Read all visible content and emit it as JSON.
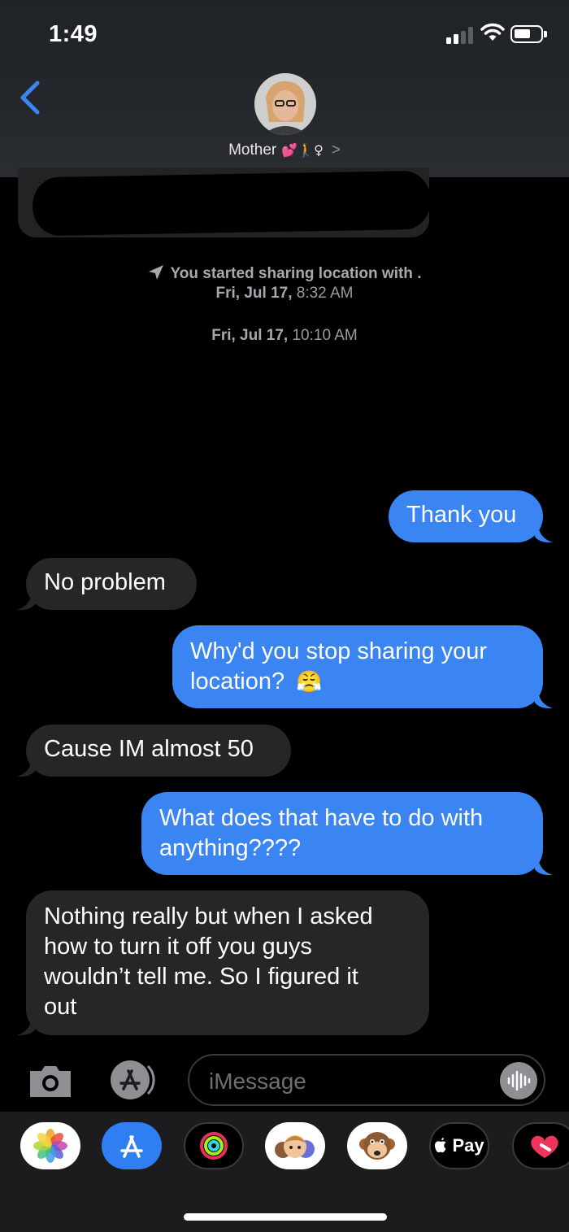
{
  "status_bar": {
    "time": "1:49"
  },
  "header": {
    "contact_name": "Mother",
    "contact_emoji": "💕🚶♀",
    "chevron": ">"
  },
  "conversation": {
    "system_lines": [
      {
        "text": "You started sharing location with .",
        "icon": "location-arrow-icon"
      },
      {
        "date": "Fri, Jul 17,",
        "time": "8:32 AM"
      },
      {
        "date": "Fri, Jul 17,",
        "time": "10:10 AM"
      }
    ],
    "messages": [
      {
        "direction": "outgoing",
        "text": "Thank you"
      },
      {
        "direction": "incoming",
        "text": "No problem"
      },
      {
        "direction": "outgoing",
        "line1": "Why'd you stop sharing your",
        "line2": "location?",
        "emoji": "😤"
      },
      {
        "direction": "incoming",
        "text": "Cause IM almost 50"
      },
      {
        "direction": "outgoing",
        "line1": "What does that have to do with",
        "line2": "anything????"
      },
      {
        "direction": "incoming",
        "line1": "Nothing really but when I asked",
        "line2": "how to turn it off you guys",
        "line3": "wouldn’t tell me. So I figured it",
        "line4": "out"
      }
    ]
  },
  "input_bar": {
    "placeholder": "iMessage"
  },
  "app_drawer": {
    "apps": [
      "photos-icon",
      "app-store-icon",
      "activity-icon",
      "memoji-icon",
      "animoji-icon",
      "apple-pay-icon",
      "digital-touch-icon"
    ],
    "apple_pay_label": "Pay"
  },
  "colors": {
    "outgoing_bubble": "#3a85f2",
    "incoming_bubble": "#262629",
    "header_bg": "#24282d",
    "link_blue": "#3a85f2"
  }
}
